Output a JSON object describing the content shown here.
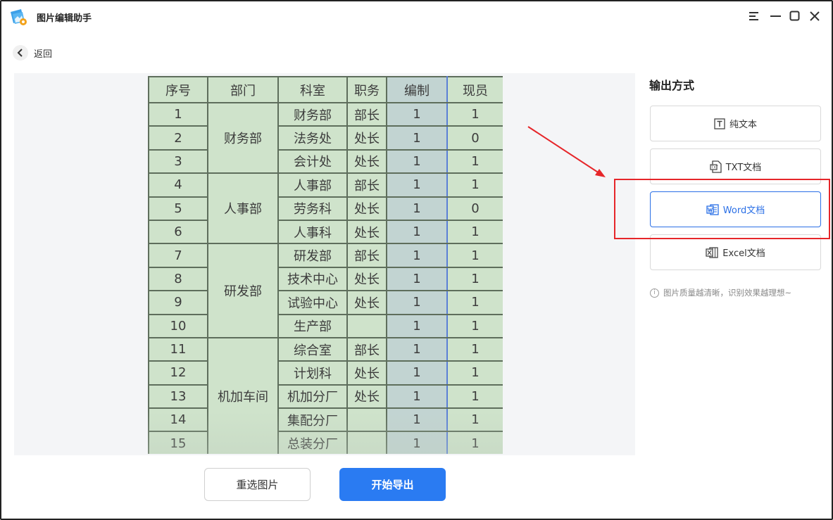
{
  "app": {
    "title": "图片编辑助手"
  },
  "window_controls": [
    "menu-icon",
    "minimize-icon",
    "maximize-icon",
    "close-icon"
  ],
  "nav": {
    "back_label": "返回"
  },
  "preview_table": {
    "headers": [
      "序号",
      "部门",
      "科室",
      "职务",
      "编制",
      "现员"
    ],
    "rows": [
      [
        "1",
        "财务部",
        "财务部",
        "部长",
        "1",
        "1"
      ],
      [
        "2",
        "",
        "法务处",
        "处长",
        "1",
        "0"
      ],
      [
        "3",
        "",
        "会计处",
        "处长",
        "1",
        "1"
      ],
      [
        "4",
        "人事部",
        "人事部",
        "部长",
        "1",
        "1"
      ],
      [
        "5",
        "",
        "劳务科",
        "处长",
        "1",
        "0"
      ],
      [
        "6",
        "",
        "人事科",
        "处长",
        "1",
        "1"
      ],
      [
        "7",
        "研发部",
        "研发部",
        "部长",
        "1",
        "1"
      ],
      [
        "8",
        "",
        "技术中心",
        "处长",
        "1",
        "1"
      ],
      [
        "9",
        "",
        "试验中心",
        "处长",
        "1",
        "1"
      ],
      [
        "10",
        "",
        "生产部",
        "",
        "1",
        "1"
      ],
      [
        "11",
        "机加车间",
        "综合室",
        "部长",
        "1",
        "1"
      ],
      [
        "12",
        "",
        "计划科",
        "处长",
        "1",
        "1"
      ],
      [
        "13",
        "",
        "机加分厂",
        "处长",
        "1",
        "1"
      ],
      [
        "14",
        "",
        "集配分厂",
        "",
        "1",
        "1"
      ],
      [
        "15",
        "",
        "总装分厂",
        "",
        "1",
        "1"
      ]
    ]
  },
  "panel": {
    "title": "输出方式",
    "options": [
      {
        "label": "纯文本",
        "icon": "text-icon"
      },
      {
        "label": "TXT文档",
        "icon": "txt-file-icon"
      },
      {
        "label": "Word文档",
        "icon": "word-file-icon",
        "selected": true
      },
      {
        "label": "Excel文档",
        "icon": "excel-file-icon"
      }
    ],
    "hint": "图片质量越清晰，识别效果越理想~"
  },
  "actions": {
    "reselect_label": "重选图片",
    "export_label": "开始导出"
  },
  "colors": {
    "accent": "#2a7bf2",
    "selected_border": "#2a6fe6",
    "annotation": "#e6262a",
    "sheet_bg": "#cfe3cb"
  }
}
